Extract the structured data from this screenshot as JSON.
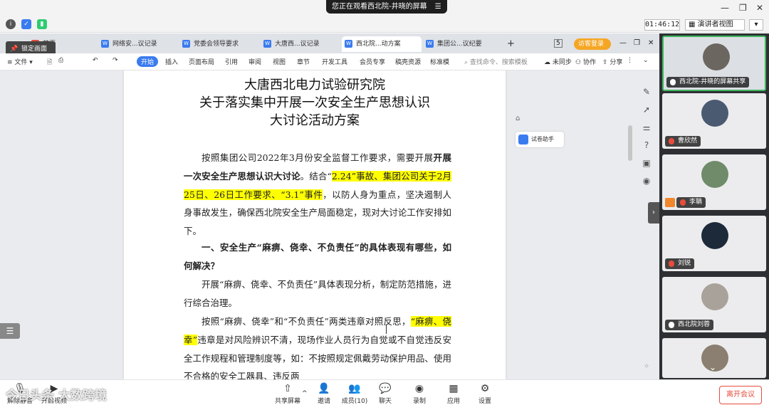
{
  "meeting": {
    "watching_label": "您正在观看西北院-井晓的屏幕",
    "timer": "01:46:12",
    "presenter_view": "演讲者视图",
    "pin_label": "锁定画面",
    "leave_label": "离开会议",
    "watermark": "今日头条 大数跨境"
  },
  "wps": {
    "tabs": [
      {
        "label": "首页"
      },
      {
        "label": "网络安...议记录"
      },
      {
        "label": "党委会领导要求"
      },
      {
        "label": "大唐西...议记录"
      },
      {
        "label": "西北院...动方案",
        "active": true
      },
      {
        "label": "集团公...议纪要"
      }
    ],
    "login_label": "访客登录",
    "ribbon": {
      "file": "文件",
      "tabs": [
        "开始",
        "插入",
        "页面布局",
        "引用",
        "审阅",
        "视图",
        "章节",
        "开发工具",
        "会员专享",
        "稿壳资源",
        "标准模"
      ],
      "active_tab": "开始",
      "search_placeholder": "查找命令、搜索模板",
      "sync": "未同步",
      "collab": "协作",
      "share": "分享"
    },
    "exam_helper": "试卷助手"
  },
  "document": {
    "title_lines": [
      "大唐西北电力试验研究院",
      "关于落实集中开展一次安全生产思想认识",
      "大讨论活动方案"
    ],
    "para1": {
      "a": "按照集团公司2022年3月份安全监督工作要求，需要开展",
      "b": "开展一次安全生产思想认识大讨论",
      "c": "。结合“",
      "h1": "2.24”事故、集团公司关于2月25日、26日工作要求、“3.1”事件",
      "d": "，以防人身为重点，坚决遏制人身事故发生，确保西北院安全生产局面稳定，现对大讨论工作安排如下。"
    },
    "heading1": "一、安全生产“麻痹、侥幸、不负责任”的具体表现有哪些，如何解决？",
    "para2": "开展“麻痹、侥幸、不负责任”具体表现分析，制定防范措施，进行综合治理。",
    "para3": {
      "a": "按照“麻痹、侥幸”和“不负责任”两类违章对照反思，",
      "h": "“麻痹、侥幸”",
      "b": "违章是对风险辨识不清，现场作业人员行为自觉或不自觉违反安全工作规程和管理制度等，如：不按照规定佩戴劳动保护用品、使用不合格的安全工器具、违反两"
    }
  },
  "participants": [
    {
      "name": "西北院-井晓的屏幕共享"
    },
    {
      "name": "曹欣然"
    },
    {
      "name": "李聃"
    },
    {
      "name": "刘锐"
    },
    {
      "name": "西北院刘蓉"
    },
    {
      "name": ""
    }
  ],
  "bottom": {
    "mute": "解除静音",
    "video": "开启视频",
    "share": "共享屏幕",
    "invite": "邀请",
    "members": "成员(10)",
    "chat": "聊天",
    "record": "录制",
    "apps": "应用",
    "settings": "设置"
  },
  "colors": {
    "highlight": "#ffff00",
    "accent": "#3a7bf0",
    "leave": "#e74c3c"
  }
}
